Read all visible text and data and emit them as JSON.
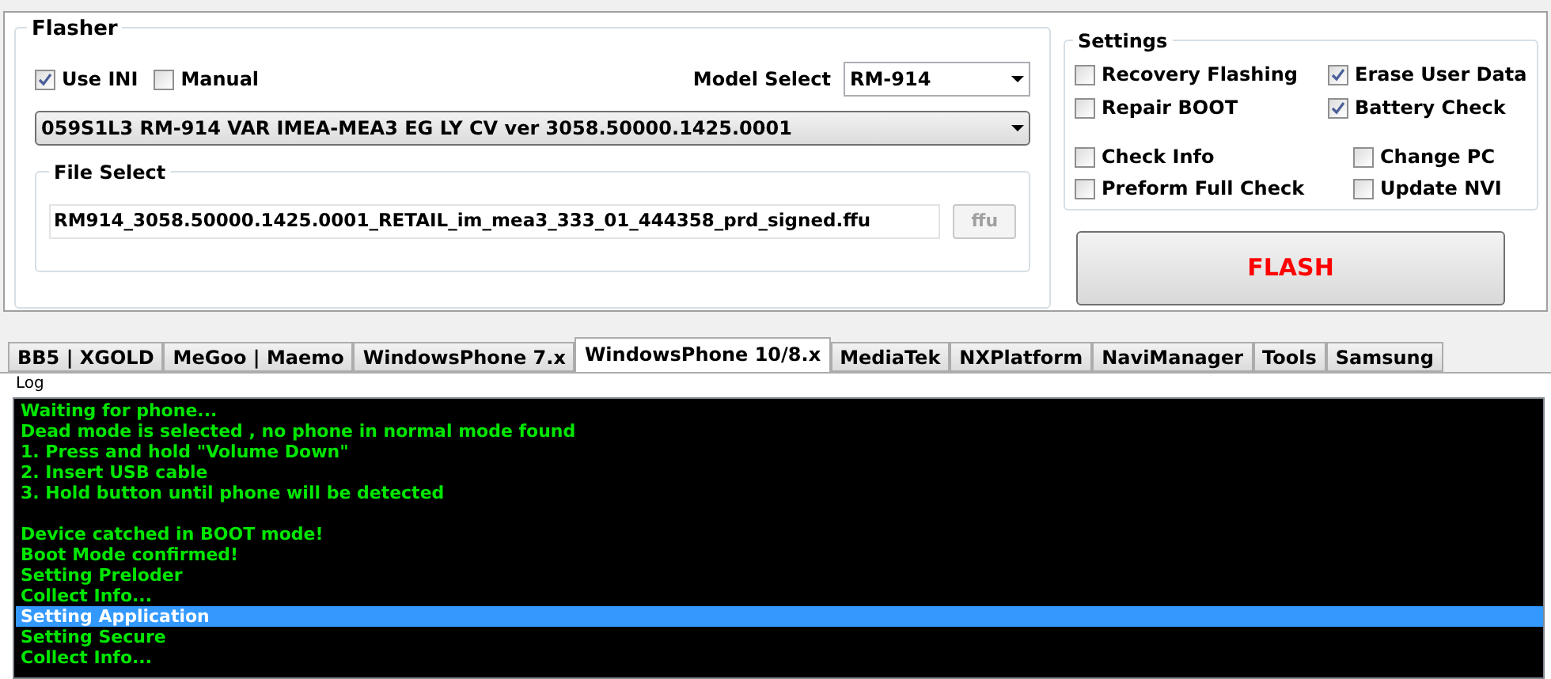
{
  "flasher": {
    "title": "Flasher",
    "options": [
      {
        "label": "Use INI",
        "checked": true
      },
      {
        "label": "Manual",
        "checked": false
      }
    ],
    "model_select": {
      "label": "Model Select",
      "value": "RM-914"
    },
    "firmware": {
      "value": "059S1L3 RM-914 VAR IMEA-MEA3 EG LY CV ver 3058.50000.1425.0001"
    },
    "file_select": {
      "title": "File Select",
      "value": "RM914_3058.50000.1425.0001_RETAIL_im_mea3_333_01_444358_prd_signed.ffu",
      "button": "ffu",
      "button_disabled": true
    }
  },
  "settings": {
    "title": "Settings",
    "rows": [
      [
        {
          "label": "Recovery Flashing",
          "checked": false
        },
        {
          "label": "Erase User Data",
          "checked": true
        }
      ],
      [
        {
          "label": "Repair BOOT",
          "checked": false
        },
        {
          "label": "Battery Check",
          "checked": true
        }
      ],
      [
        {
          "label": "Check Info",
          "checked": false
        },
        {
          "label": "Change PC",
          "checked": false
        }
      ],
      [
        {
          "label": "Preform Full Check",
          "checked": false
        },
        {
          "label": "Update NVI",
          "checked": false
        }
      ]
    ]
  },
  "flash_button": "FLASH",
  "platform_tabs": [
    {
      "label": "BB5 | XGOLD",
      "selected": false
    },
    {
      "label": "MeGoo | Maemo",
      "selected": false
    },
    {
      "label": "WindowsPhone 7.x",
      "selected": false
    },
    {
      "label": "WindowsPhone 10/8.x",
      "selected": true
    },
    {
      "label": "MediaTek",
      "selected": false
    },
    {
      "label": "NXPlatform",
      "selected": false
    },
    {
      "label": "NaviManager",
      "selected": false
    },
    {
      "label": "Tools",
      "selected": false
    },
    {
      "label": "Samsung",
      "selected": false
    }
  ],
  "log": {
    "title": "Log",
    "lines": [
      {
        "text": "Waiting for phone...",
        "selected": false
      },
      {
        "text": "Dead mode is selected , no phone in normal mode found",
        "selected": false
      },
      {
        "text": "1. Press and hold \"Volume Down\"",
        "selected": false
      },
      {
        "text": "2. Insert USB cable",
        "selected": false
      },
      {
        "text": "3. Hold button until phone will be detected",
        "selected": false
      },
      {
        "selected": false
      },
      {
        "text": "Device catched in BOOT mode!",
        "selected": false
      },
      {
        "text": "Boot Mode confirmed!",
        "selected": false
      },
      {
        "text": "Setting Preloder",
        "selected": false
      },
      {
        "text": "Collect Info...",
        "selected": false
      },
      {
        "text": "Setting Application",
        "selected": true
      },
      {
        "text": "Setting Secure",
        "selected": false
      },
      {
        "text": "Collect Info...",
        "selected": false
      }
    ]
  }
}
